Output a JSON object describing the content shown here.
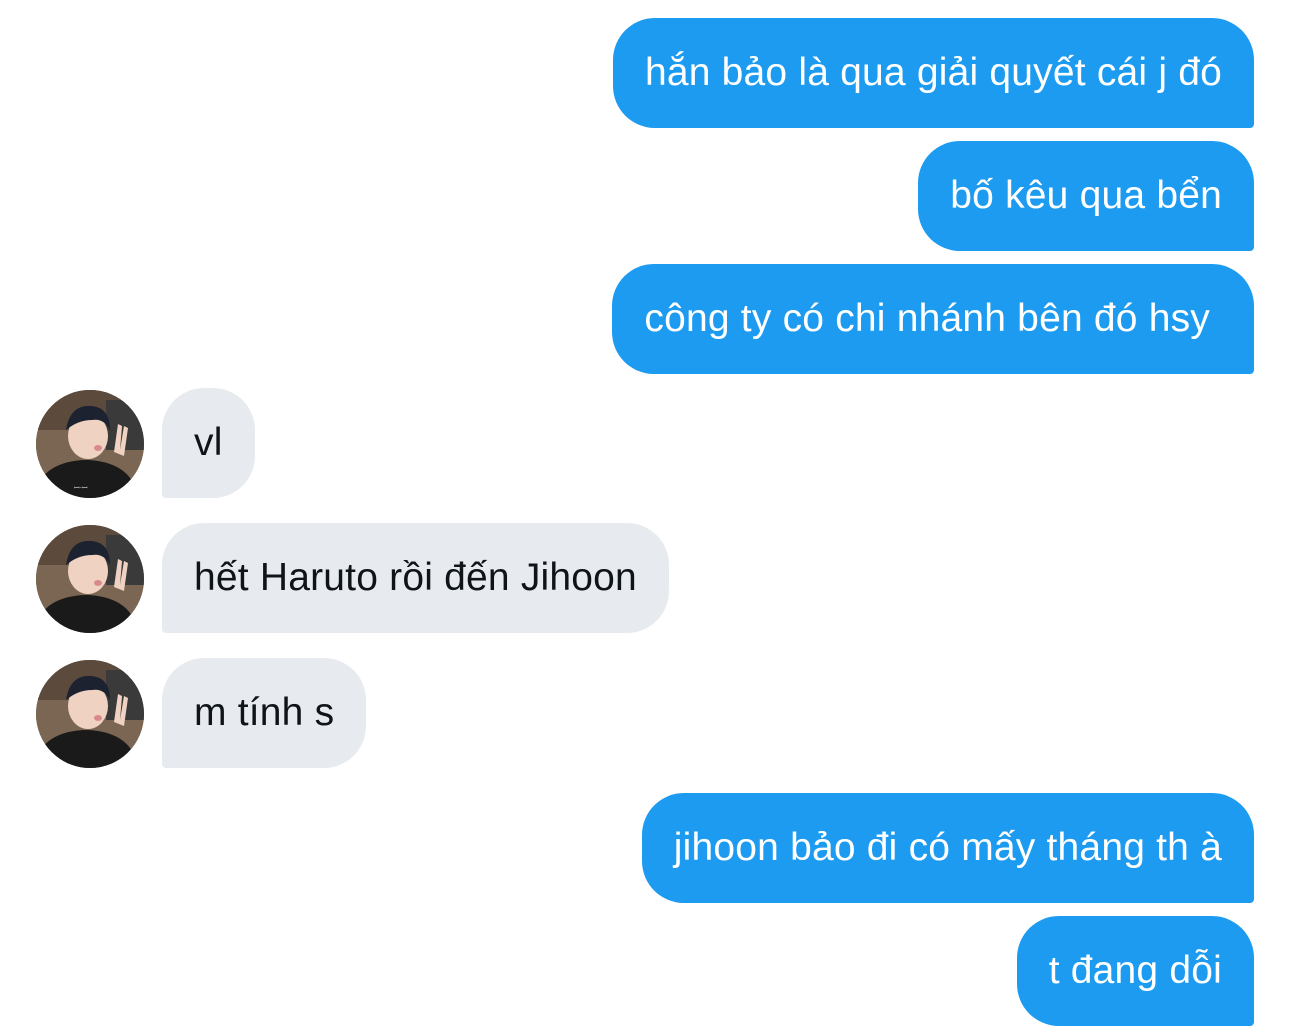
{
  "conversation": {
    "messages": [
      {
        "direction": "outgoing",
        "text": "hắn bảo là qua giải quyết cái j đó"
      },
      {
        "direction": "outgoing",
        "text": "bố kêu qua bển"
      },
      {
        "direction": "outgoing",
        "text": "công ty có chi nhánh bên đó hsy"
      },
      {
        "direction": "incoming",
        "text": "vl",
        "avatar": "user-avatar"
      },
      {
        "direction": "incoming",
        "text": "hết Haruto rồi đến Jihoon",
        "avatar": "user-avatar"
      },
      {
        "direction": "incoming",
        "text": "m tính s",
        "avatar": "user-avatar"
      },
      {
        "direction": "outgoing",
        "text": "jihoon bảo đi có mấy tháng th à"
      },
      {
        "direction": "outgoing",
        "text": "t đang dỗi"
      }
    ]
  },
  "colors": {
    "outgoing_bubble": "#1d9bf0",
    "outgoing_text": "#ffffff",
    "incoming_bubble": "#e7ebef",
    "incoming_text": "#0f1419",
    "background": "#ffffff"
  }
}
